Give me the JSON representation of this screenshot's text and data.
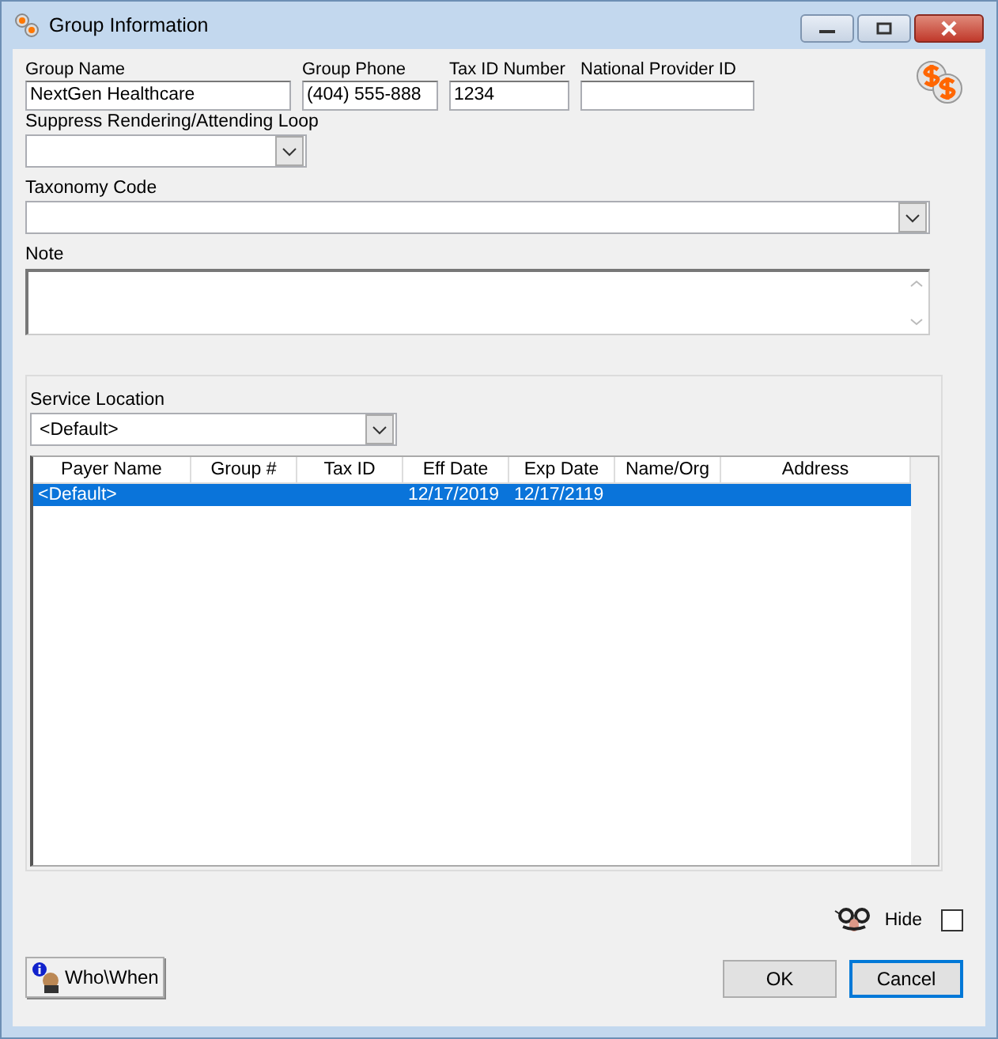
{
  "window": {
    "title": "Group Information"
  },
  "fields": [
    {
      "label": "Group Name",
      "value": "NextGen Healthcare"
    },
    {
      "label": "Group Phone",
      "value": "(404) 555-888"
    },
    {
      "label": "Tax ID Number",
      "value": "1234"
    },
    {
      "label": "National Provider ID"
    }
  ],
  "suppress_loop": {
    "label": "Suppress Rendering/Attending Loop"
  },
  "taxonomy_code": {
    "label": "Taxonomy Code"
  },
  "note": {
    "label": "Note"
  },
  "service_location": {
    "label": "Service Location",
    "value": "<Default>"
  },
  "table": {
    "columns": [
      "Payer Name",
      "Group #",
      "Tax ID",
      "Eff Date",
      "Exp Date",
      "Name/Org",
      "Address"
    ],
    "rows": [
      {
        "cells": [
          "<Default>",
          null,
          null,
          "12/17/2019",
          "12/17/2119",
          null,
          null
        ],
        "selected": true
      }
    ]
  },
  "hide": {
    "label": "Hide",
    "checked": false
  },
  "who_when_button": "Who\\When",
  "buttons": [
    {
      "label": "OK",
      "focused": false
    },
    {
      "label": "Cancel",
      "focused": true
    }
  ]
}
